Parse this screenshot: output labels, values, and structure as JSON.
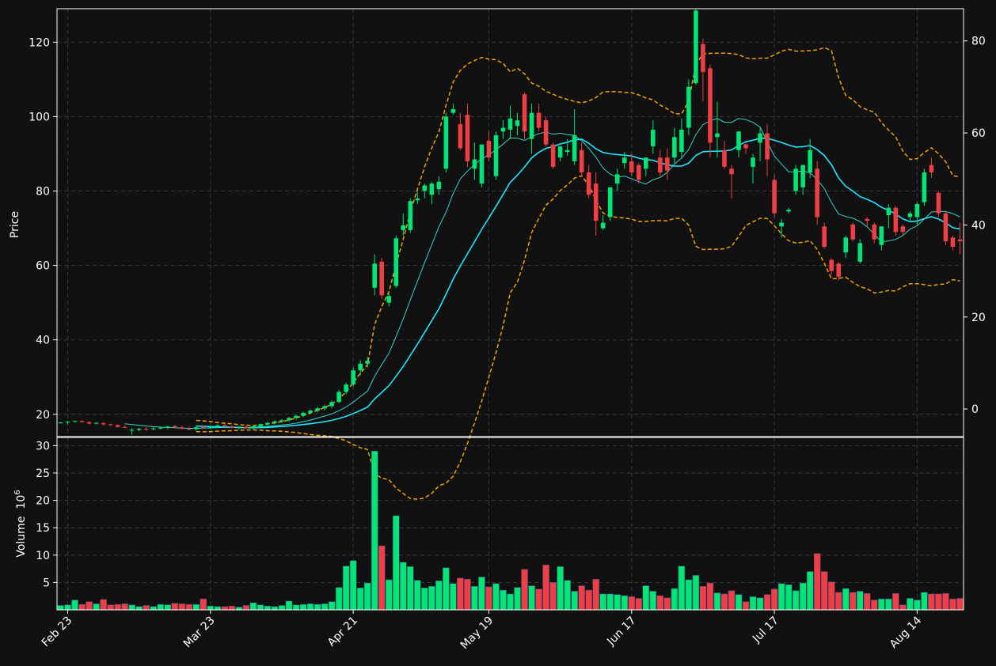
{
  "chart_data": {
    "type": "candlestick",
    "price_axis": {
      "label": "Price",
      "ticks": [
        20,
        40,
        60,
        80,
        100,
        120
      ],
      "range": [
        14,
        129
      ]
    },
    "secondary_axis": {
      "ticks": [
        0,
        20,
        40,
        60,
        80
      ],
      "range": [
        -6,
        87
      ]
    },
    "volume_axis": {
      "label": "Volume",
      "unit": "10",
      "unit_exp": "6",
      "ticks": [
        5,
        10,
        15,
        20,
        25,
        30
      ],
      "range": [
        0,
        31.5
      ]
    },
    "x_ticks": [
      {
        "i": 1,
        "label": "Feb 23"
      },
      {
        "i": 21,
        "label": "Mar 23"
      },
      {
        "i": 41,
        "label": "Apr 21"
      },
      {
        "i": 60,
        "label": "May 19"
      },
      {
        "i": 80,
        "label": "Jun 17"
      },
      {
        "i": 100,
        "label": "Jul 17"
      },
      {
        "i": 120,
        "label": "Aug 14"
      }
    ],
    "grid": true,
    "colors": {
      "up": "#00e676",
      "down": "#ef3e46",
      "ma_fast": "#33d6cc",
      "ma_slow": "#1fe6ff",
      "bands": "#f4a300",
      "background": "#111111",
      "grid": "#3a3a3a"
    },
    "candles_ohlcv": [
      [
        17.7,
        17.9,
        17.5,
        17.8,
        0.8
      ],
      [
        17.8,
        18.2,
        17.3,
        18.0,
        0.9
      ],
      [
        18.0,
        18.3,
        17.8,
        18.2,
        1.8
      ],
      [
        18.2,
        18.3,
        17.8,
        17.9,
        1.0
      ],
      [
        17.9,
        18.1,
        17.3,
        17.5,
        1.5
      ],
      [
        17.5,
        17.9,
        17.3,
        17.7,
        1.1
      ],
      [
        17.6,
        17.9,
        17.0,
        17.3,
        1.9
      ],
      [
        17.3,
        17.5,
        16.9,
        17.1,
        0.9
      ],
      [
        17.1,
        17.3,
        16.5,
        16.6,
        1.0
      ],
      [
        16.6,
        17.0,
        16.3,
        16.4,
        1.1
      ],
      [
        15.6,
        16.3,
        14.5,
        15.8,
        0.9
      ],
      [
        15.8,
        16.4,
        15.4,
        16.1,
        0.6
      ],
      [
        16.1,
        16.5,
        15.6,
        16.0,
        0.8
      ],
      [
        16.0,
        16.6,
        15.7,
        16.2,
        0.6
      ],
      [
        16.2,
        16.7,
        15.9,
        16.4,
        1.0
      ],
      [
        16.4,
        16.9,
        16.0,
        16.7,
        0.9
      ],
      [
        16.8,
        17.2,
        16.3,
        16.5,
        1.2
      ],
      [
        16.5,
        16.9,
        16.0,
        16.1,
        1.1
      ],
      [
        16.1,
        16.6,
        15.7,
        16.0,
        1.0
      ],
      [
        16.0,
        16.8,
        15.6,
        16.5,
        1.0
      ],
      [
        16.6,
        16.9,
        16.2,
        16.3,
        2.0
      ],
      [
        16.3,
        16.8,
        16.0,
        16.6,
        0.7
      ],
      [
        16.6,
        17.3,
        16.3,
        17.0,
        0.6
      ],
      [
        17.0,
        17.4,
        16.5,
        16.7,
        0.6
      ],
      [
        16.7,
        17.0,
        16.2,
        16.4,
        0.7
      ],
      [
        16.4,
        16.9,
        15.9,
        16.6,
        0.5
      ],
      [
        16.6,
        17.0,
        16.1,
        16.2,
        0.8
      ],
      [
        16.2,
        17.0,
        15.7,
        16.8,
        1.3
      ],
      [
        16.8,
        17.5,
        16.5,
        17.3,
        0.9
      ],
      [
        17.3,
        17.9,
        17.0,
        17.7,
        0.7
      ],
      [
        17.7,
        18.3,
        17.3,
        18.1,
        0.6
      ],
      [
        18.1,
        18.7,
        17.7,
        18.4,
        0.8
      ],
      [
        18.4,
        19.3,
        18.0,
        19.0,
        1.6
      ],
      [
        19.0,
        19.9,
        18.6,
        19.6,
        0.9
      ],
      [
        19.6,
        20.7,
        19.2,
        20.4,
        1.0
      ],
      [
        20.4,
        21.3,
        20.0,
        21.0,
        1.1
      ],
      [
        21.0,
        22.0,
        20.5,
        21.6,
        1.0
      ],
      [
        21.6,
        22.6,
        21.0,
        22.2,
        1.1
      ],
      [
        22.2,
        23.7,
        21.6,
        23.3,
        1.5
      ],
      [
        23.3,
        26.6,
        23.0,
        26.0,
        4.1
      ],
      [
        26.0,
        28.5,
        25.4,
        28.0,
        8.0
      ],
      [
        28.0,
        32.5,
        27.5,
        31.8,
        9.0
      ],
      [
        31.8,
        34.5,
        30.5,
        33.6,
        4.0
      ],
      [
        33.6,
        35.5,
        32.6,
        34.4,
        4.9
      ],
      [
        54.0,
        63.0,
        52.0,
        60.5,
        29.0
      ],
      [
        61.0,
        62.0,
        51.0,
        52.0,
        11.7
      ],
      [
        50.0,
        52.5,
        49.0,
        51.8,
        5.5
      ],
      [
        54.5,
        68.0,
        54.0,
        67.3,
        17.2
      ],
      [
        69.5,
        74.0,
        68.0,
        70.8,
        8.7
      ],
      [
        69.5,
        78.0,
        68.8,
        77.3,
        7.9
      ],
      [
        77.5,
        80.0,
        76.5,
        78.0,
        5.4
      ],
      [
        80.0,
        82.0,
        78.0,
        81.5,
        4.0
      ],
      [
        79.0,
        82.5,
        76.5,
        82.0,
        4.3
      ],
      [
        80.5,
        84.0,
        79.0,
        82.5,
        5.3
      ],
      [
        86.0,
        101.0,
        85.0,
        100.0,
        7.7
      ],
      [
        101.0,
        103.5,
        100.5,
        102.0,
        4.8
      ],
      [
        98.0,
        101.0,
        91.0,
        91.5,
        5.8
      ],
      [
        100.5,
        103.5,
        86.5,
        88.0,
        5.6
      ],
      [
        86.0,
        93.0,
        83.0,
        88.5,
        4.3
      ],
      [
        82.0,
        91.0,
        81.0,
        92.5,
        6.0
      ],
      [
        93.5,
        96.0,
        88.0,
        89.0,
        4.2
      ],
      [
        84.0,
        96.0,
        83.0,
        95.0,
        4.8
      ],
      [
        96.0,
        99.0,
        94.0,
        97.0,
        3.6
      ],
      [
        96.5,
        103.0,
        94.0,
        99.5,
        2.9
      ],
      [
        97.5,
        101.0,
        95.0,
        99.0,
        4.1
      ],
      [
        106.0,
        106.5,
        94.0,
        96.0,
        7.4
      ],
      [
        94.0,
        103.5,
        90.0,
        101.0,
        4.4
      ],
      [
        101.0,
        103.5,
        96.0,
        97.0,
        3.8
      ],
      [
        99.0,
        100.0,
        92.0,
        92.5,
        8.2
      ],
      [
        92.5,
        93.0,
        86.0,
        86.5,
        5.0
      ],
      [
        89.0,
        90.5,
        88.0,
        92.0,
        7.9
      ],
      [
        90.5,
        94.0,
        89.5,
        91.0,
        5.4
      ],
      [
        88.0,
        102.0,
        87.0,
        95.0,
        3.4
      ],
      [
        91.0,
        93.0,
        84.0,
        85.0,
        4.4
      ],
      [
        85.0,
        87.0,
        78.0,
        79.0,
        3.6
      ],
      [
        82.0,
        85.0,
        68.0,
        72.0,
        5.6
      ],
      [
        70.0,
        73.5,
        69.5,
        71.5,
        2.9
      ],
      [
        73.0,
        79.5,
        72.0,
        81.0,
        2.9
      ],
      [
        82.0,
        86.0,
        80.0,
        84.5,
        2.8
      ],
      [
        87.5,
        90.5,
        86.0,
        89.0,
        2.6
      ],
      [
        88.0,
        90.0,
        84.0,
        85.0,
        2.4
      ],
      [
        87.0,
        87.5,
        82.0,
        83.0,
        2.1
      ],
      [
        86.0,
        87.5,
        84.0,
        89.0,
        4.4
      ],
      [
        92.0,
        99.0,
        90.0,
        96.5,
        3.4
      ],
      [
        89.0,
        91.0,
        84.0,
        85.0,
        2.6
      ],
      [
        89.0,
        91.5,
        83.0,
        85.5,
        2.2
      ],
      [
        89.0,
        97.0,
        87.5,
        94.5,
        3.9
      ],
      [
        90.5,
        99.5,
        89.0,
        96.5,
        8.0
      ],
      [
        97.0,
        110.0,
        95.0,
        108.0,
        5.5
      ],
      [
        109.0,
        129.0,
        108.5,
        128.5,
        6.3
      ],
      [
        119.5,
        121.0,
        104.0,
        112.0,
        4.3
      ],
      [
        113.0,
        114.0,
        89.0,
        93.0,
        4.9
      ],
      [
        94.5,
        104.0,
        89.0,
        95.5,
        3.1
      ],
      [
        91.0,
        93.5,
        86.0,
        86.5,
        2.9
      ],
      [
        86.0,
        87.0,
        78.0,
        84.5,
        3.5
      ],
      [
        91.0,
        96.0,
        89.0,
        96.0,
        2.8
      ],
      [
        92.5,
        93.0,
        90.0,
        91.5,
        1.5
      ],
      [
        86.5,
        90.0,
        82.0,
        89.0,
        2.4
      ],
      [
        93.0,
        97.0,
        88.0,
        95.5,
        2.2
      ],
      [
        95.5,
        98.0,
        84.0,
        88.5,
        2.8
      ],
      [
        83.0,
        84.5,
        73.0,
        74.0,
        3.8
      ],
      [
        70.5,
        72.5,
        67.5,
        71.5,
        4.8
      ],
      [
        74.5,
        75.5,
        74.0,
        75.0,
        4.6
      ],
      [
        80.0,
        87.0,
        79.0,
        86.0,
        3.5
      ],
      [
        81.0,
        86.0,
        79.0,
        87.0,
        4.9
      ],
      [
        85.0,
        94.0,
        83.5,
        91.0,
        7.0
      ],
      [
        86.0,
        88.0,
        71.0,
        73.0,
        10.3
      ],
      [
        70.5,
        71.5,
        64.5,
        65.0,
        7.0
      ],
      [
        61.5,
        62.0,
        57.5,
        58.5,
        5.1
      ],
      [
        60.5,
        61.0,
        56.0,
        57.0,
        3.2
      ],
      [
        63.5,
        68.0,
        62.0,
        67.5,
        3.9
      ],
      [
        71.0,
        71.5,
        66.5,
        67.0,
        3.2
      ],
      [
        61.0,
        67.0,
        60.5,
        66.0,
        3.4
      ],
      [
        72.5,
        73.0,
        70.5,
        72.0,
        3.0
      ],
      [
        71.0,
        71.5,
        66.0,
        67.0,
        1.8
      ],
      [
        65.5,
        70.0,
        64.0,
        70.5,
        2.0
      ],
      [
        73.5,
        76.5,
        70.0,
        75.5,
        2.0
      ],
      [
        75.5,
        76.0,
        68.0,
        69.0,
        3.0
      ],
      [
        70.5,
        71.0,
        68.0,
        69.0,
        0.9
      ],
      [
        73.0,
        74.5,
        72.0,
        74.0,
        2.1
      ],
      [
        73.0,
        77.0,
        71.0,
        76.5,
        1.8
      ],
      [
        77.0,
        86.0,
        76.0,
        85.0,
        3.2
      ],
      [
        87.0,
        89.0,
        83.5,
        85.0,
        2.9
      ],
      [
        79.5,
        80.0,
        73.0,
        74.0,
        2.9
      ],
      [
        74.0,
        74.5,
        65.5,
        66.5,
        3.0
      ],
      [
        67.5,
        68.0,
        64.0,
        65.0,
        2.0
      ],
      [
        67.0,
        71.5,
        63.0,
        66.5,
        2.1
      ]
    ]
  }
}
